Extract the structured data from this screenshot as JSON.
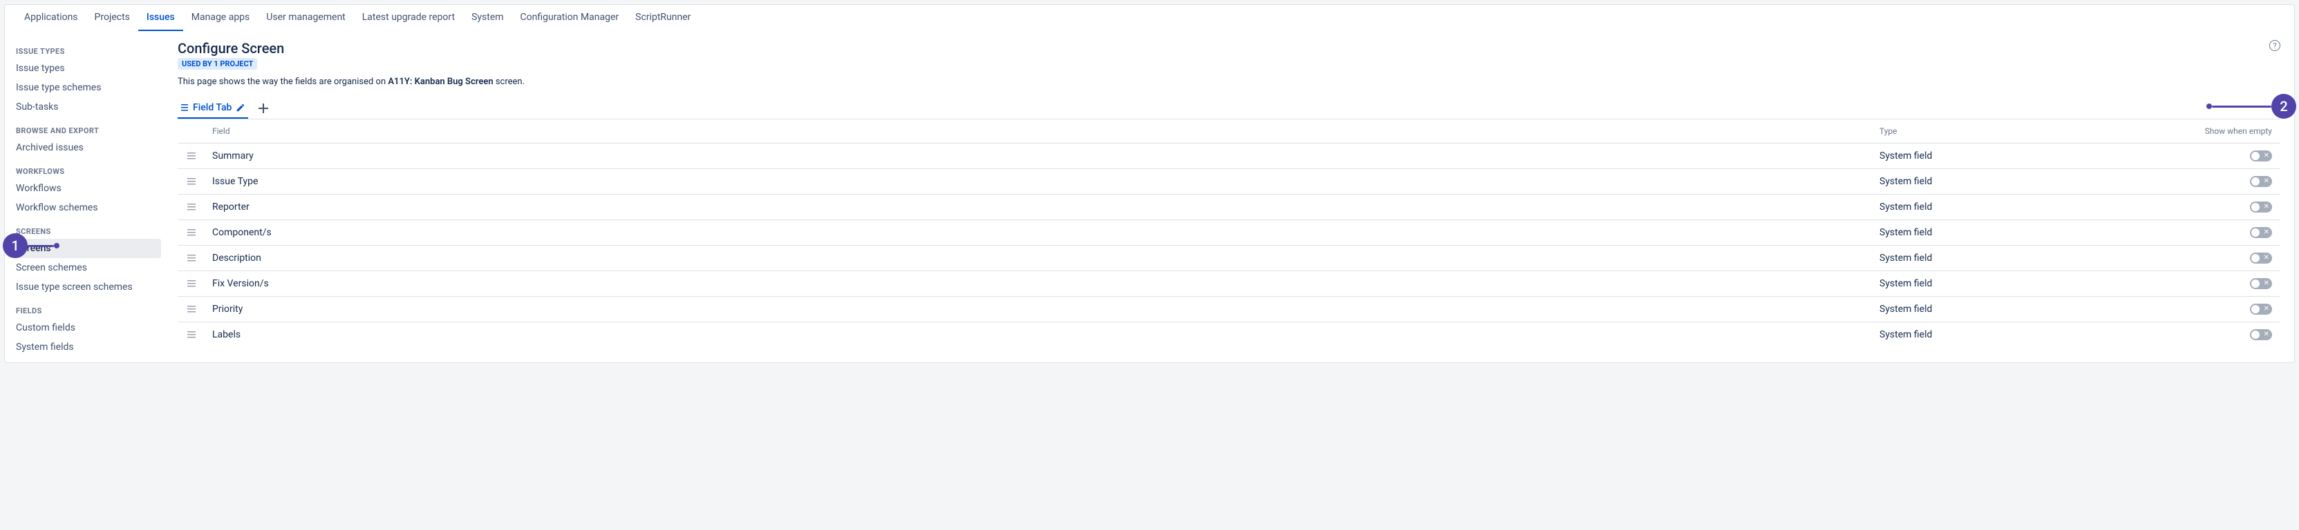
{
  "nav": {
    "tabs": [
      {
        "label": "Applications",
        "active": false
      },
      {
        "label": "Projects",
        "active": false
      },
      {
        "label": "Issues",
        "active": true
      },
      {
        "label": "Manage apps",
        "active": false
      },
      {
        "label": "User management",
        "active": false
      },
      {
        "label": "Latest upgrade report",
        "active": false
      },
      {
        "label": "System",
        "active": false
      },
      {
        "label": "Configuration Manager",
        "active": false
      },
      {
        "label": "ScriptRunner",
        "active": false
      }
    ]
  },
  "sidebar": {
    "groups": [
      {
        "title": "ISSUE TYPES",
        "items": [
          {
            "label": "Issue types"
          },
          {
            "label": "Issue type schemes"
          },
          {
            "label": "Sub-tasks"
          }
        ]
      },
      {
        "title": "BROWSE AND EXPORT",
        "items": [
          {
            "label": "Archived issues"
          }
        ]
      },
      {
        "title": "WORKFLOWS",
        "items": [
          {
            "label": "Workflows"
          },
          {
            "label": "Workflow schemes"
          }
        ]
      },
      {
        "title": "SCREENS",
        "items": [
          {
            "label": "Screens",
            "active": true
          },
          {
            "label": "Screen schemes"
          },
          {
            "label": "Issue type screen schemes"
          }
        ]
      },
      {
        "title": "FIELDS",
        "items": [
          {
            "label": "Custom fields"
          },
          {
            "label": "System fields"
          }
        ]
      }
    ]
  },
  "page": {
    "title": "Configure Screen",
    "badge": "USED BY 1 PROJECT",
    "desc_pre": "This page shows the way the fields are organised on ",
    "desc_bold": "A11Y: Kanban Bug Screen",
    "desc_post": " screen.",
    "fieldTab": "Field Tab",
    "columns": {
      "field": "Field",
      "type": "Type",
      "empty": "Show when empty"
    },
    "rows": [
      {
        "field": "Summary",
        "type": "System field"
      },
      {
        "field": "Issue Type",
        "type": "System field"
      },
      {
        "field": "Reporter",
        "type": "System field"
      },
      {
        "field": "Component/s",
        "type": "System field"
      },
      {
        "field": "Description",
        "type": "System field"
      },
      {
        "field": "Fix Version/s",
        "type": "System field"
      },
      {
        "field": "Priority",
        "type": "System field"
      },
      {
        "field": "Labels",
        "type": "System field"
      }
    ]
  },
  "annot": {
    "a1": "1",
    "a2": "2"
  }
}
